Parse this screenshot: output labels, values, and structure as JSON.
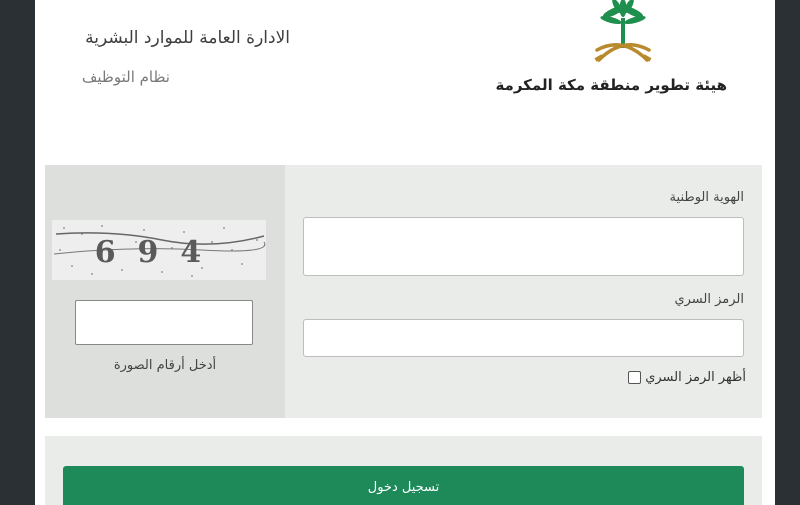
{
  "header": {
    "title": "الادارة العامة للموارد البشرية",
    "subtitle": "نظام التوظيف",
    "org_name": "هيئة تطوير منطقة مكة المكرمة"
  },
  "form": {
    "national_id_label": "الهوية الوطنية",
    "national_id_value": "",
    "password_label": "الرمز السري",
    "password_value": "",
    "show_password_label": "أظهر الرمز السري",
    "captcha_label": "أدخل أرقام الصورة",
    "captcha_value": ""
  },
  "captcha": {
    "digits": "694"
  },
  "login_button": {
    "label": "تسجيل دخول"
  },
  "colors": {
    "accent": "#1e8a5a",
    "logo_green": "#1f8f4e",
    "logo_gold": "#b98a2d"
  }
}
